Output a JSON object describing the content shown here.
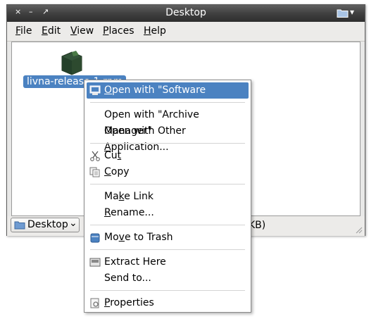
{
  "window": {
    "title": "Desktop",
    "close_glyph": "×",
    "minimize_glyph": "–",
    "maximize_glyph": "↗",
    "folder_menu_arrow": "▾"
  },
  "menubar": [
    {
      "pre": "",
      "u": "F",
      "post": "ile"
    },
    {
      "pre": "",
      "u": "E",
      "post": "dit"
    },
    {
      "pre": "",
      "u": "V",
      "post": "iew"
    },
    {
      "pre": "",
      "u": "P",
      "post": "laces"
    },
    {
      "pre": "",
      "u": "H",
      "post": "elp"
    }
  ],
  "file": {
    "label": "livna-release-1.rpm",
    "icon": "package-icon",
    "icon_color": "#2e4a2a"
  },
  "status": {
    "location": "Desktop",
    "location_arrow": "⌄",
    "text": "KB)"
  },
  "context_menu": {
    "open_software_installer": {
      "pre": "",
      "u": "O",
      "post": "pen with \"Software Installer\""
    },
    "open_archive_manager": {
      "pre": "Open with \"Archive Manager\"",
      "u": "",
      "post": ""
    },
    "open_other": {
      "pre": "Open with Other ",
      "u": "A",
      "post": "pplication..."
    },
    "cut": {
      "pre": "Cu",
      "u": "t",
      "post": ""
    },
    "copy": {
      "pre": "",
      "u": "C",
      "post": "opy"
    },
    "make_link": {
      "pre": "Ma",
      "u": "k",
      "post": "e Link"
    },
    "rename": {
      "pre": "",
      "u": "R",
      "post": "ename..."
    },
    "move_to_trash": {
      "pre": "Mo",
      "u": "v",
      "post": "e to Trash"
    },
    "extract_here": {
      "pre": "Extract Here",
      "u": "",
      "post": ""
    },
    "send_to": {
      "pre": "Send to...",
      "u": "",
      "post": ""
    },
    "properties": {
      "pre": "",
      "u": "P",
      "post": "roperties"
    }
  },
  "colors": {
    "selection": "#4b82c1",
    "titlebar": "#3a3a3a"
  }
}
